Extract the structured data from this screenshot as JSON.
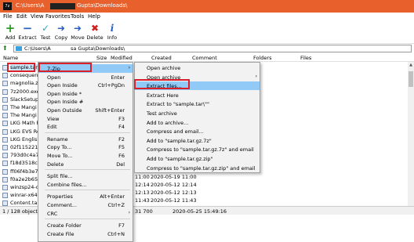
{
  "window": {
    "title_prefix": "C:\\Users\\A",
    "title_suffix": "Gupta\\Downloads\\",
    "app_icon": "7z"
  },
  "menubar": [
    "File",
    "Edit",
    "View",
    "Favorites",
    "Tools",
    "Help"
  ],
  "toolbar": [
    {
      "label": "Add",
      "icon": "plus-icon",
      "glyph": "+",
      "color": "#2a9a2a"
    },
    {
      "label": "Extract",
      "icon": "minus-icon",
      "glyph": "−",
      "color": "#2a5fc0"
    },
    {
      "label": "Test",
      "icon": "check-icon",
      "glyph": "✓",
      "color": "#2aa6c8"
    },
    {
      "label": "Copy",
      "icon": "copy-arrow-icon",
      "glyph": "➜",
      "color": "#2a5fc0"
    },
    {
      "label": "Move",
      "icon": "move-arrow-icon",
      "glyph": "➜",
      "color": "#2a5fc0"
    },
    {
      "label": "Delete",
      "icon": "delete-x-icon",
      "glyph": "✖",
      "color": "#d02020"
    },
    {
      "label": "Info",
      "icon": "info-icon",
      "glyph": "i",
      "color": "#2a5fc0"
    }
  ],
  "address": {
    "prefix": "C:\\Users\\A",
    "suffix": "sa Gupta\\Downloads\\"
  },
  "columns": [
    "Name",
    "Size",
    "Modified",
    "Created",
    "Comment",
    "Folders",
    "Files"
  ],
  "files": [
    "sample.tar",
    "consequenc",
    "magnolia.zi",
    "7z2000.exe",
    "SlackSetup.e",
    "The Mangi G",
    "The Mangi G",
    "LKG Math R",
    "LKG EVS Re",
    "LKG English",
    "02f1152213",
    "793d0c4a7b",
    "f18d3518c5",
    "ff06f4b3e7d",
    "f0a2e2b65ff",
    "winzsp24-dc",
    "winrar-x64-",
    "Content.tar."
  ],
  "date_rows": [
    {
      "modified": "11:00",
      "created": "2020-05-19 11:00"
    },
    {
      "modified": "12:14",
      "created": "2020-05-12 12:14"
    },
    {
      "modified": "12:13",
      "created": "2020-05-12 12:13"
    },
    {
      "modified": "11:43",
      "created": "2020-05-12 11:43"
    }
  ],
  "statusbar": {
    "count": "1 / 128 object(s)",
    "size": "31 700",
    "date": "2020-05-25 15:49:16"
  },
  "context_menu": [
    {
      "label": "7-Zip",
      "shortcut": "",
      "submenu": true,
      "highlight": true
    },
    {
      "label": "Open",
      "shortcut": "Enter"
    },
    {
      "label": "Open Inside",
      "shortcut": "Ctrl+PgDn"
    },
    {
      "label": "Open Inside *",
      "shortcut": ""
    },
    {
      "label": "Open Inside #",
      "shortcut": ""
    },
    {
      "label": "Open Outside",
      "shortcut": "Shift+Enter"
    },
    {
      "label": "View",
      "shortcut": "F3"
    },
    {
      "label": "Edit",
      "shortcut": "F4"
    },
    {
      "label": "Rename",
      "shortcut": "F2"
    },
    {
      "label": "Copy To...",
      "shortcut": "F5"
    },
    {
      "label": "Move To...",
      "shortcut": "F6"
    },
    {
      "label": "Delete",
      "shortcut": "Del"
    },
    {
      "label": "Split file...",
      "shortcut": ""
    },
    {
      "label": "Combine files...",
      "shortcut": ""
    },
    {
      "label": "Properties",
      "shortcut": "Alt+Enter"
    },
    {
      "label": "Comment...",
      "shortcut": "Ctrl+Z"
    },
    {
      "label": "CRC",
      "shortcut": "",
      "submenu": true
    },
    {
      "label": "Create Folder",
      "shortcut": "F7"
    },
    {
      "label": "Create File",
      "shortcut": "Ctrl+N"
    }
  ],
  "submenu": [
    {
      "label": "Open archive",
      "submenu": false
    },
    {
      "label": "Open archive",
      "submenu": true
    },
    {
      "label": "Extract files...",
      "highlight": true
    },
    {
      "label": "Extract Here"
    },
    {
      "label": "Extract to \"sample.tar\\\"\""
    },
    {
      "label": "Test archive"
    },
    {
      "label": "Add to archive..."
    },
    {
      "label": "Compress and email..."
    },
    {
      "label": "Add to \"sample.tar.gz.7z\""
    },
    {
      "label": "Compress to \"sample.tar.gz.7z\" and email"
    },
    {
      "label": "Add to \"sample.tar.gz.zip\""
    },
    {
      "label": "Compress to \"sample.tar.gz.zip\" and email"
    }
  ],
  "colors": {
    "titlebar": "#e8612c",
    "highlight": "#91c9f7",
    "callout": "#d9202a"
  }
}
